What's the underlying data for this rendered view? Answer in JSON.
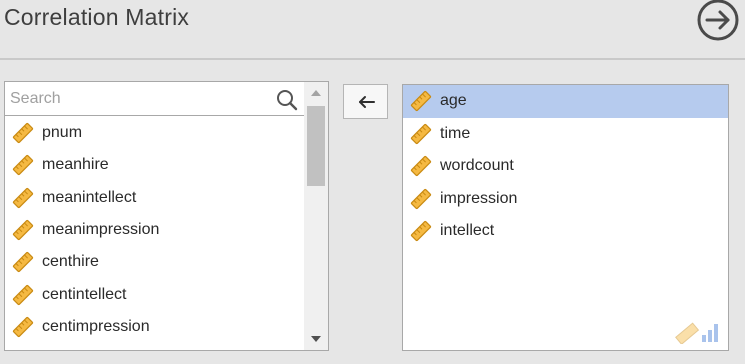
{
  "header": {
    "title": "Correlation Matrix"
  },
  "source": {
    "search_placeholder": "Search",
    "items": [
      {
        "label": "pnum"
      },
      {
        "label": "meanhire"
      },
      {
        "label": "meanintellect"
      },
      {
        "label": "meanimpression"
      },
      {
        "label": "centhire"
      },
      {
        "label": "centintellect"
      },
      {
        "label": "centimpression"
      }
    ]
  },
  "target": {
    "items": [
      {
        "label": "age",
        "selected": true
      },
      {
        "label": "time"
      },
      {
        "label": "wordcount"
      },
      {
        "label": "impression"
      },
      {
        "label": "intellect"
      }
    ]
  },
  "colors": {
    "selection": "#b6cbee",
    "ruler_fill": "#f5b942",
    "ruler_stroke": "#c98a12"
  },
  "icons": {
    "variable": "continuous-ruler-icon",
    "move": "arrow-left-icon",
    "run": "arrow-right-circle-icon"
  }
}
